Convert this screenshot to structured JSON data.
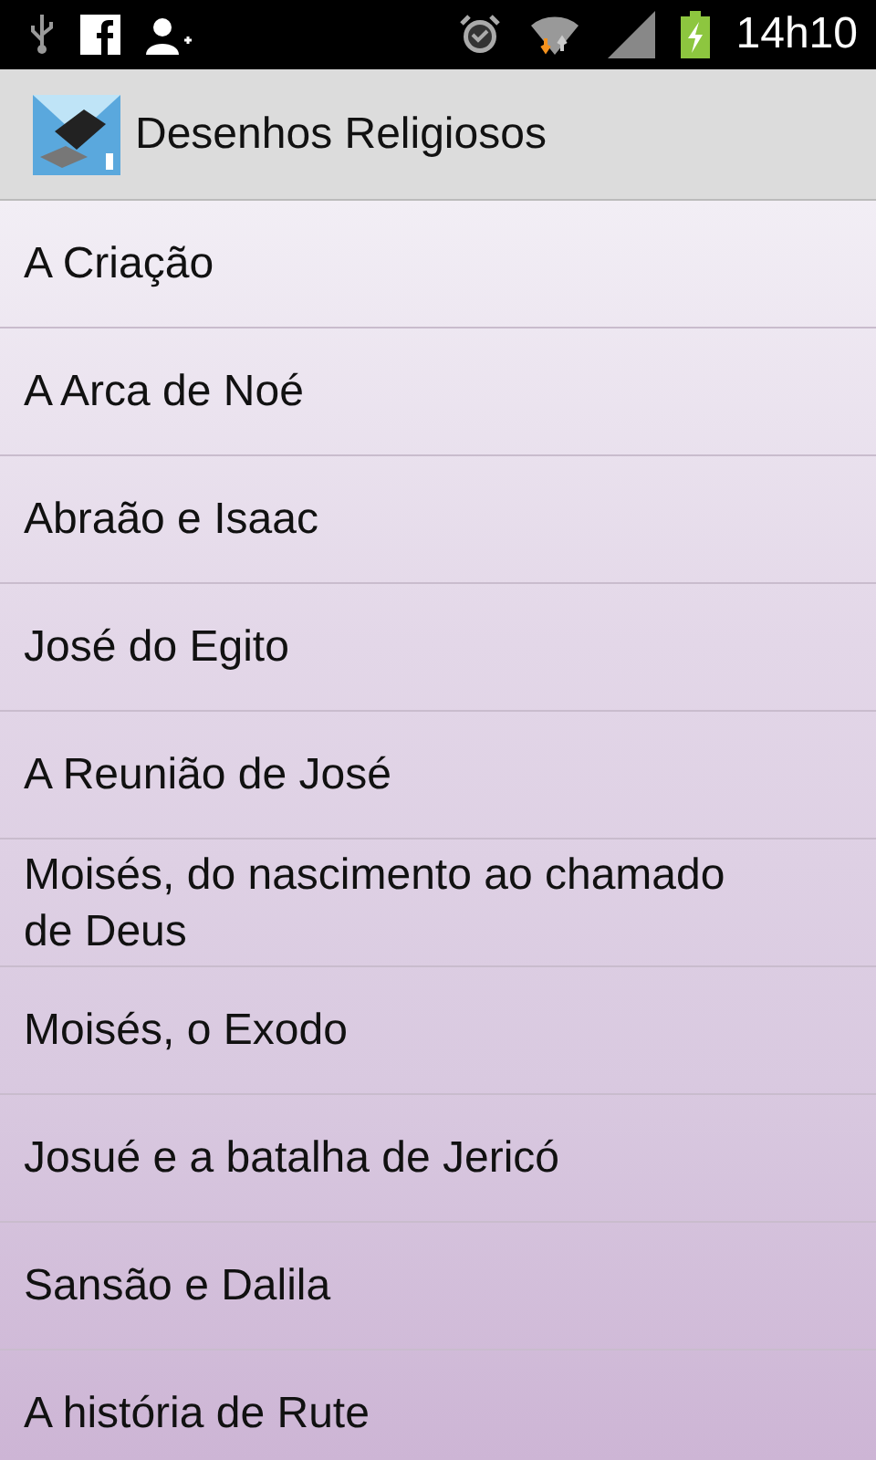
{
  "status_bar": {
    "time": "14h10"
  },
  "action_bar": {
    "title": "Desenhos Religiosos"
  },
  "items": [
    {
      "label": "A Criação"
    },
    {
      "label": "A Arca de Noé"
    },
    {
      "label": "Abraão e Isaac"
    },
    {
      "label": "José do Egito"
    },
    {
      "label": "A Reunião de José"
    },
    {
      "label": "Moisés, do nascimento ao chamado de Deus"
    },
    {
      "label": "Moisés, o Exodo"
    },
    {
      "label": "Josué e a batalha de Jericó"
    },
    {
      "label": "Sansão e Dalila"
    },
    {
      "label": "A história de Rute"
    }
  ]
}
